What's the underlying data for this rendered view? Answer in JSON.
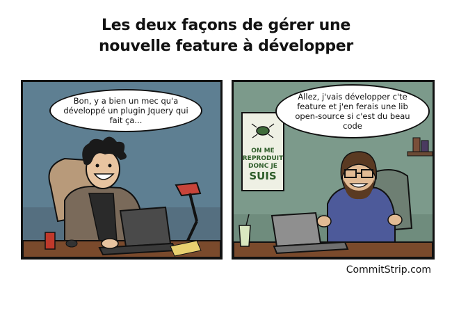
{
  "title": {
    "line1": "Les deux façons de gérer une",
    "line2": "nouvelle feature à développer"
  },
  "panel_left": {
    "speech": "Bon, y a bien un mec qu'a développé un plugin Jquery qui fait ça..."
  },
  "panel_right": {
    "speech": "Allez, j'vais développer c'te feature et j'en ferais une lib open-source si c'est du beau code",
    "poster": {
      "line1": "ON ME",
      "line2": "REPRODUIT",
      "line3": "DONC JE",
      "line4": "SUIS"
    }
  },
  "credit": "CommitStrip.com",
  "colors": {
    "left_background": "#5e7f92",
    "right_background": "#7c9a8b",
    "desk": "#7a4a2c"
  }
}
